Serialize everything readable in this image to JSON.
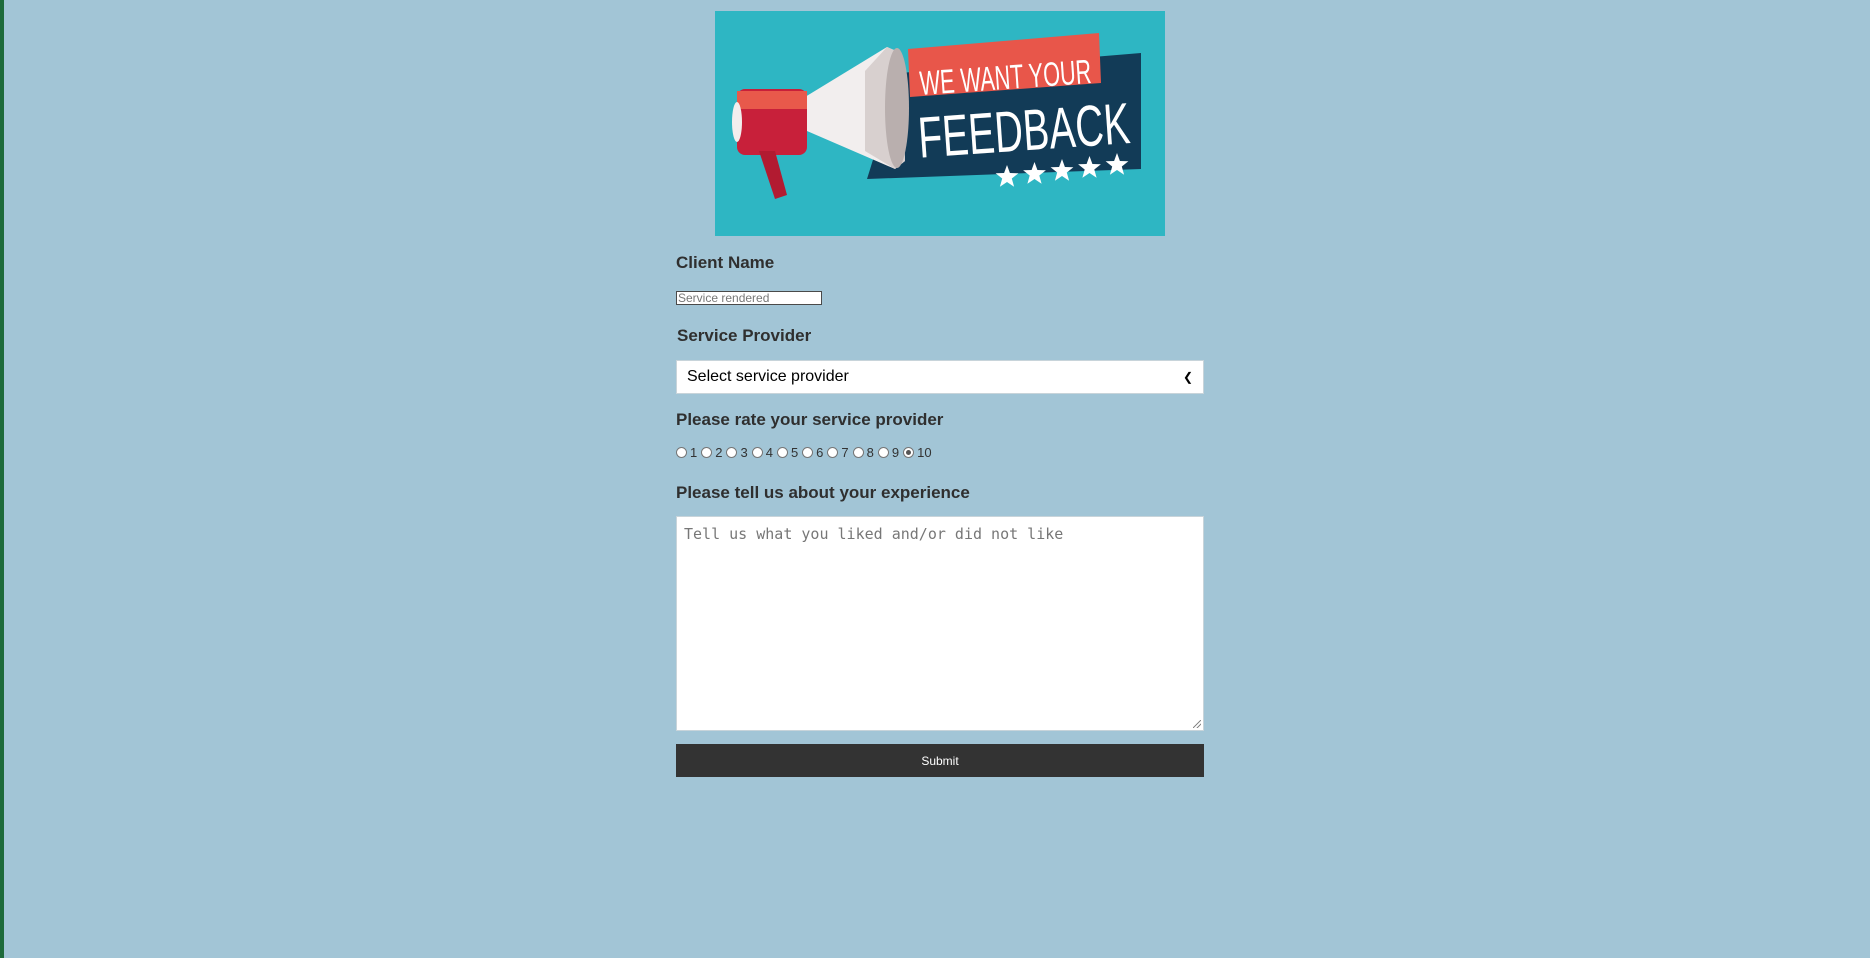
{
  "banner": {
    "line1": "WE WANT YOUR",
    "line2": "FEEDBACK",
    "colors": {
      "background": "#2eb6c3",
      "ribbon": "#e8564a",
      "panel": "#123b57",
      "megaphone": "#c8203a"
    },
    "stars": 5
  },
  "form": {
    "client_name_label": "Client Name",
    "client_name_placeholder": "Service rendered",
    "service_provider_label": "Service Provider",
    "service_provider_selected": "Select service provider",
    "rating_label": "Please rate your service provider",
    "rating_options": [
      "1",
      "2",
      "3",
      "4",
      "5",
      "6",
      "7",
      "8",
      "9",
      "10"
    ],
    "rating_selected": "10",
    "experience_label": "Please tell us about your experience",
    "experience_placeholder": "Tell us what you liked and/or did not like",
    "submit_label": "Submit"
  },
  "colors": {
    "page_background": "#a2c5d6",
    "submit_background": "#333333",
    "left_edge": "#1e6b3b"
  }
}
